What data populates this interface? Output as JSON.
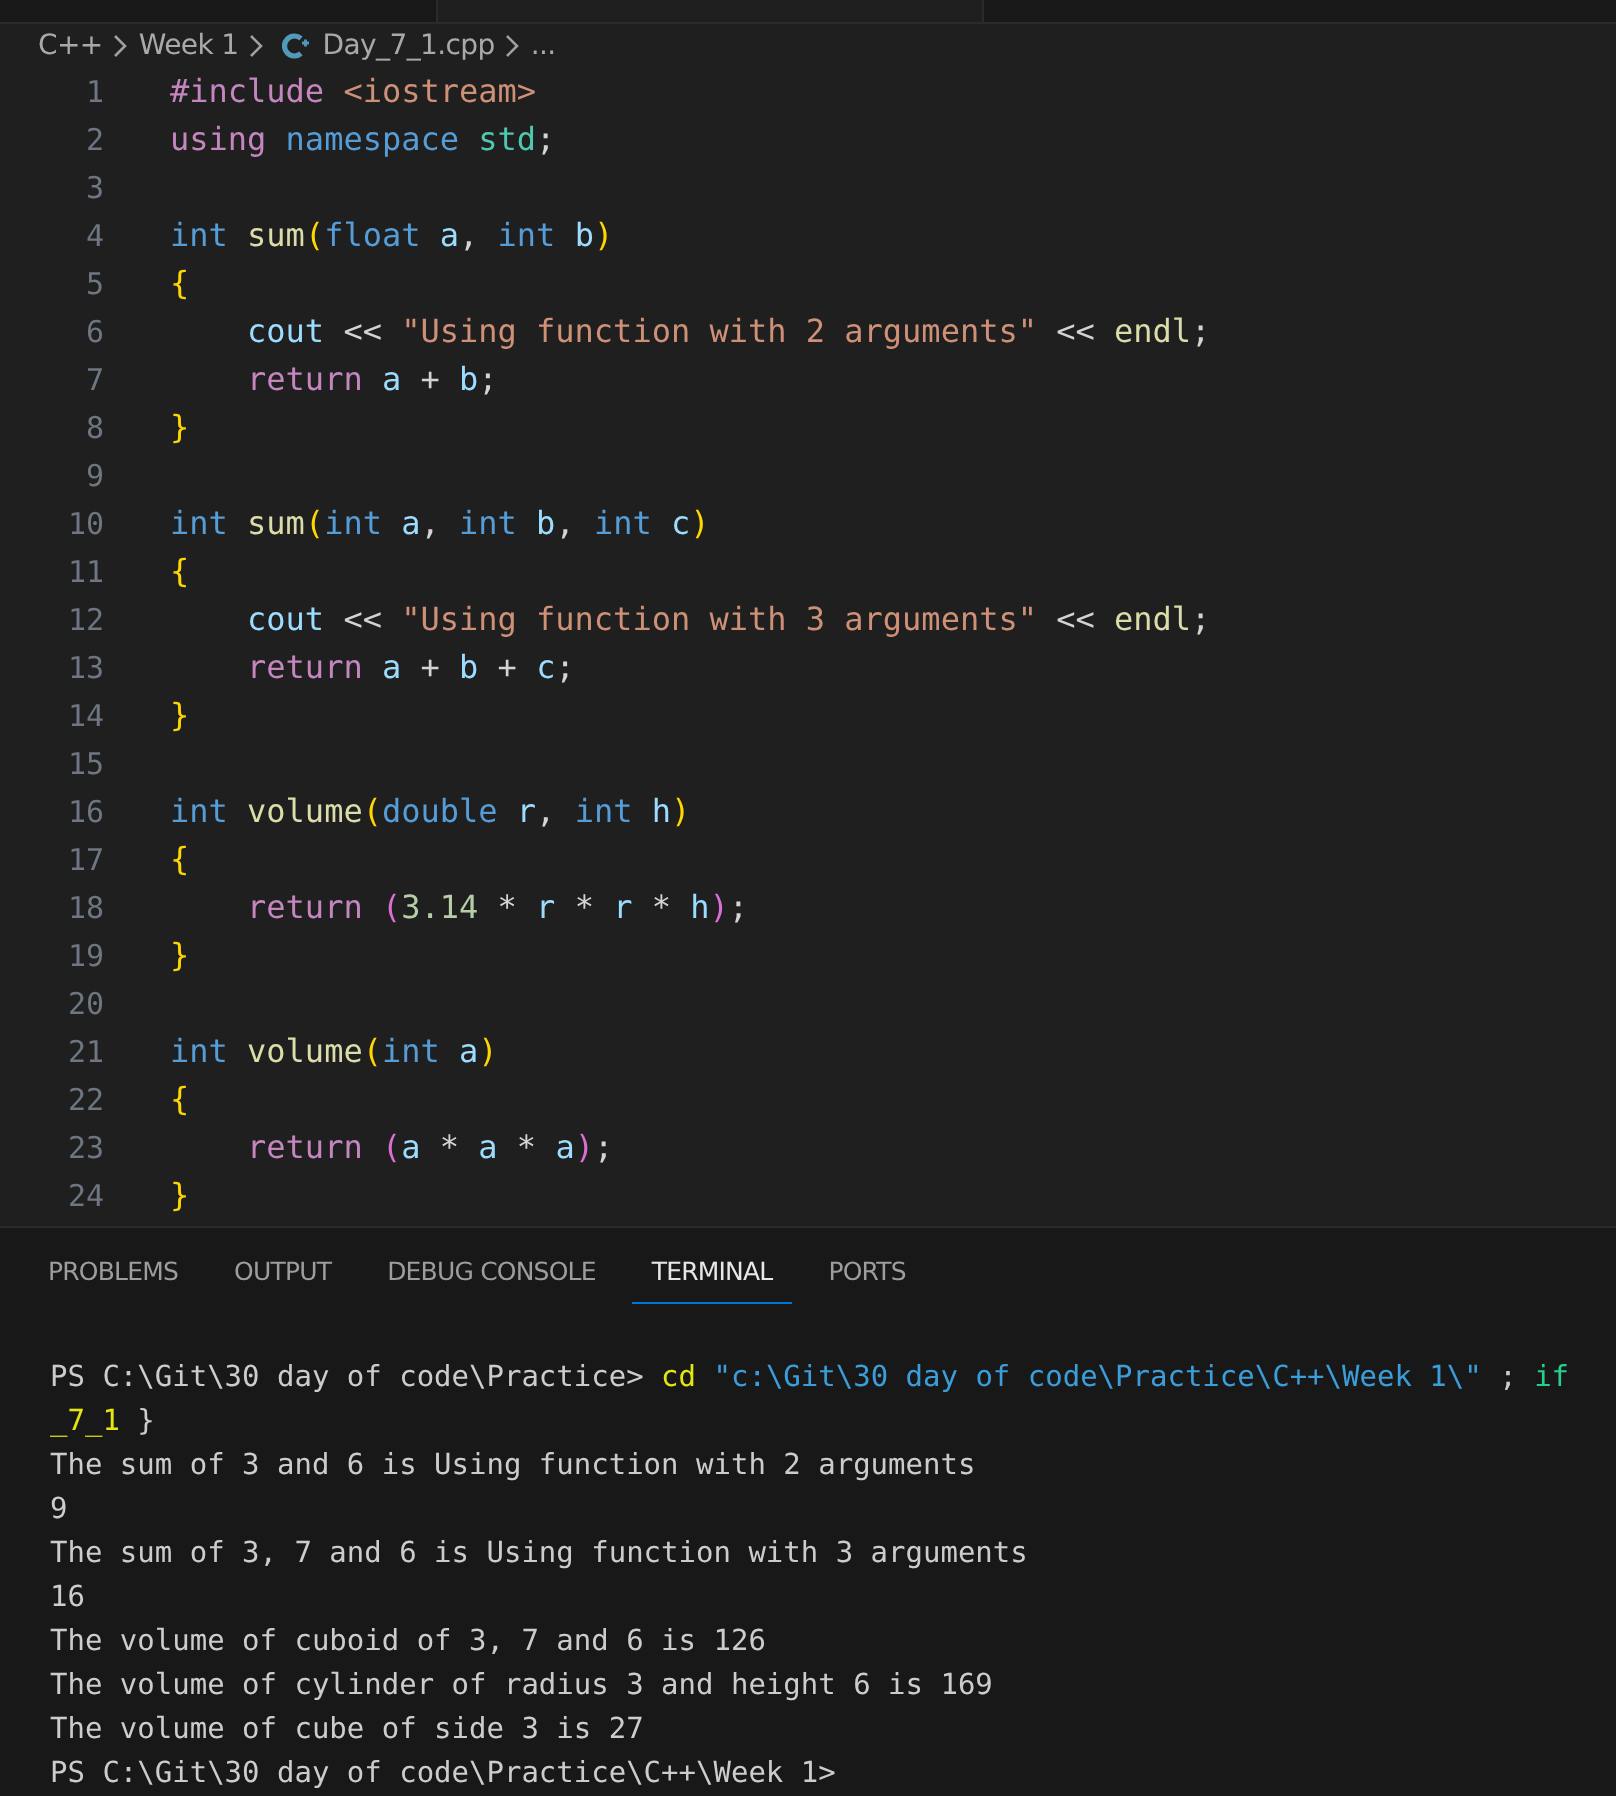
{
  "breadcrumb": {
    "items": [
      {
        "text": "C++",
        "kind": "folder"
      },
      {
        "text": "Week 1",
        "kind": "folder"
      },
      {
        "text": "Day_7_1.cpp",
        "kind": "file"
      }
    ],
    "more": "..."
  },
  "editor": {
    "lines": [
      {
        "number": "1",
        "tokens": [
          {
            "text": "#include ",
            "color": "#c586c0"
          },
          {
            "text": "<iostream>",
            "color": "#ce9178"
          }
        ]
      },
      {
        "number": "2",
        "tokens": [
          {
            "text": "using ",
            "color": "#c586c0"
          },
          {
            "text": "namespace ",
            "color": "#569cd6"
          },
          {
            "text": "std",
            "color": "#4ec9b0"
          },
          {
            "text": ";",
            "color": "#d4d4d4"
          }
        ]
      },
      {
        "number": "3"
      },
      {
        "number": "4",
        "tokens": [
          {
            "text": "int ",
            "color": "#569cd6"
          },
          {
            "text": "sum",
            "color": "#dcdcaa"
          },
          {
            "text": "(",
            "color": "#ffd700"
          },
          {
            "text": "float ",
            "color": "#569cd6"
          },
          {
            "text": "a",
            "color": "#9cdcfe"
          },
          {
            "text": ", ",
            "color": "#d4d4d4"
          },
          {
            "text": "int ",
            "color": "#569cd6"
          },
          {
            "text": "b",
            "color": "#9cdcfe"
          },
          {
            "text": ")",
            "color": "#ffd700"
          }
        ]
      },
      {
        "number": "5",
        "tokens": [
          {
            "text": "{",
            "color": "#ffd700"
          }
        ]
      },
      {
        "number": "6",
        "tokens": [
          {
            "text": "    cout",
            "color": "#9cdcfe"
          },
          {
            "text": " << ",
            "color": "#d4d4d4"
          },
          {
            "text": "\"Using function with 2 arguments\"",
            "color": "#ce9178"
          },
          {
            "text": " << ",
            "color": "#d4d4d4"
          },
          {
            "text": "endl",
            "color": "#dcdcaa"
          },
          {
            "text": ";",
            "color": "#d4d4d4"
          }
        ]
      },
      {
        "number": "7",
        "tokens": [
          {
            "text": "    return ",
            "color": "#c586c0"
          },
          {
            "text": "a",
            "color": "#9cdcfe"
          },
          {
            "text": " + ",
            "color": "#d4d4d4"
          },
          {
            "text": "b",
            "color": "#9cdcfe"
          },
          {
            "text": ";",
            "color": "#d4d4d4"
          }
        ]
      },
      {
        "number": "8",
        "tokens": [
          {
            "text": "}",
            "color": "#ffd700"
          }
        ]
      },
      {
        "number": "9"
      },
      {
        "number": "10",
        "tokens": [
          {
            "text": "int ",
            "color": "#569cd6"
          },
          {
            "text": "sum",
            "color": "#dcdcaa"
          },
          {
            "text": "(",
            "color": "#ffd700"
          },
          {
            "text": "int ",
            "color": "#569cd6"
          },
          {
            "text": "a",
            "color": "#9cdcfe"
          },
          {
            "text": ", ",
            "color": "#d4d4d4"
          },
          {
            "text": "int ",
            "color": "#569cd6"
          },
          {
            "text": "b",
            "color": "#9cdcfe"
          },
          {
            "text": ", ",
            "color": "#d4d4d4"
          },
          {
            "text": "int ",
            "color": "#569cd6"
          },
          {
            "text": "c",
            "color": "#9cdcfe"
          },
          {
            "text": ")",
            "color": "#ffd700"
          }
        ]
      },
      {
        "number": "11",
        "tokens": [
          {
            "text": "{",
            "color": "#ffd700"
          }
        ]
      },
      {
        "number": "12",
        "tokens": [
          {
            "text": "    cout",
            "color": "#9cdcfe"
          },
          {
            "text": " << ",
            "color": "#d4d4d4"
          },
          {
            "text": "\"Using function with 3 arguments\"",
            "color": "#ce9178"
          },
          {
            "text": " << ",
            "color": "#d4d4d4"
          },
          {
            "text": "endl",
            "color": "#dcdcaa"
          },
          {
            "text": ";",
            "color": "#d4d4d4"
          }
        ]
      },
      {
        "number": "13",
        "tokens": [
          {
            "text": "    return ",
            "color": "#c586c0"
          },
          {
            "text": "a",
            "color": "#9cdcfe"
          },
          {
            "text": " + ",
            "color": "#d4d4d4"
          },
          {
            "text": "b",
            "color": "#9cdcfe"
          },
          {
            "text": " + ",
            "color": "#d4d4d4"
          },
          {
            "text": "c",
            "color": "#9cdcfe"
          },
          {
            "text": ";",
            "color": "#d4d4d4"
          }
        ]
      },
      {
        "number": "14",
        "tokens": [
          {
            "text": "}",
            "color": "#ffd700"
          }
        ]
      },
      {
        "number": "15"
      },
      {
        "number": "16",
        "tokens": [
          {
            "text": "int ",
            "color": "#569cd6"
          },
          {
            "text": "volume",
            "color": "#dcdcaa"
          },
          {
            "text": "(",
            "color": "#ffd700"
          },
          {
            "text": "double ",
            "color": "#569cd6"
          },
          {
            "text": "r",
            "color": "#9cdcfe"
          },
          {
            "text": ", ",
            "color": "#d4d4d4"
          },
          {
            "text": "int ",
            "color": "#569cd6"
          },
          {
            "text": "h",
            "color": "#9cdcfe"
          },
          {
            "text": ")",
            "color": "#ffd700"
          }
        ]
      },
      {
        "number": "17",
        "tokens": [
          {
            "text": "{",
            "color": "#ffd700"
          }
        ]
      },
      {
        "number": "18",
        "tokens": [
          {
            "text": "    return ",
            "color": "#c586c0"
          },
          {
            "text": "(",
            "color": "#da70d6"
          },
          {
            "text": "3.14",
            "color": "#b5cea8"
          },
          {
            "text": " * ",
            "color": "#d4d4d4"
          },
          {
            "text": "r",
            "color": "#9cdcfe"
          },
          {
            "text": " * ",
            "color": "#d4d4d4"
          },
          {
            "text": "r",
            "color": "#9cdcfe"
          },
          {
            "text": " * ",
            "color": "#d4d4d4"
          },
          {
            "text": "h",
            "color": "#9cdcfe"
          },
          {
            "text": ")",
            "color": "#da70d6"
          },
          {
            "text": ";",
            "color": "#d4d4d4"
          }
        ]
      },
      {
        "number": "19",
        "tokens": [
          {
            "text": "}",
            "color": "#ffd700"
          }
        ]
      },
      {
        "number": "20"
      },
      {
        "number": "21",
        "tokens": [
          {
            "text": "int ",
            "color": "#569cd6"
          },
          {
            "text": "volume",
            "color": "#dcdcaa"
          },
          {
            "text": "(",
            "color": "#ffd700"
          },
          {
            "text": "int ",
            "color": "#569cd6"
          },
          {
            "text": "a",
            "color": "#9cdcfe"
          },
          {
            "text": ")",
            "color": "#ffd700"
          }
        ]
      },
      {
        "number": "22",
        "tokens": [
          {
            "text": "{",
            "color": "#ffd700"
          }
        ]
      },
      {
        "number": "23",
        "tokens": [
          {
            "text": "    return ",
            "color": "#c586c0"
          },
          {
            "text": "(",
            "color": "#da70d6"
          },
          {
            "text": "a",
            "color": "#9cdcfe"
          },
          {
            "text": " * ",
            "color": "#d4d4d4"
          },
          {
            "text": "a",
            "color": "#9cdcfe"
          },
          {
            "text": " * ",
            "color": "#d4d4d4"
          },
          {
            "text": "a",
            "color": "#9cdcfe"
          },
          {
            "text": ")",
            "color": "#da70d6"
          },
          {
            "text": ";",
            "color": "#d4d4d4"
          }
        ]
      },
      {
        "number": "24",
        "tokens": [
          {
            "text": "}",
            "color": "#ffd700"
          }
        ]
      }
    ]
  },
  "panel": {
    "tabs": [
      {
        "label": "PROBLEMS",
        "selected": false
      },
      {
        "label": "OUTPUT",
        "selected": false
      },
      {
        "label": "DEBUG CONSOLE",
        "selected": false
      },
      {
        "label": "TERMINAL",
        "selected": true
      },
      {
        "label": "PORTS",
        "selected": false
      }
    ],
    "terminal": {
      "lines": [
        {
          "tokens": [
            {
              "text": "PS C:\\Git\\30 day of code\\Practice> ",
              "color": "#cccccc"
            },
            {
              "text": "cd ",
              "color": "#e5e510"
            },
            {
              "text": "\"c:\\Git\\30 day of code\\Practice\\C++\\Week 1\\\"",
              "color": "#3b9edb"
            },
            {
              "text": " ; ",
              "color": "#cccccc"
            },
            {
              "text": "if",
              "color": "#23d18b"
            }
          ]
        },
        {
          "tokens": [
            {
              "text": "_7_1",
              "color": "#e5e510"
            },
            {
              "text": " }",
              "color": "#cccccc"
            }
          ]
        },
        {
          "tokens": [
            {
              "text": "The sum of 3 and 6 is Using function with 2 arguments",
              "color": "#cccccc"
            }
          ]
        },
        {
          "tokens": [
            {
              "text": "9",
              "color": "#cccccc"
            }
          ]
        },
        {
          "tokens": [
            {
              "text": "The sum of 3, 7 and 6 is Using function with 3 arguments",
              "color": "#cccccc"
            }
          ]
        },
        {
          "tokens": [
            {
              "text": "16",
              "color": "#cccccc"
            }
          ]
        },
        {
          "tokens": [
            {
              "text": "The volume of cuboid of 3, 7 and 6 is 126",
              "color": "#cccccc"
            }
          ]
        },
        {
          "tokens": [
            {
              "text": "The volume of cylinder of radius 3 and height 6 is 169",
              "color": "#cccccc"
            }
          ]
        },
        {
          "tokens": [
            {
              "text": "The volume of cube of side 3 is 27",
              "color": "#cccccc"
            }
          ]
        },
        {
          "tokens": [
            {
              "text": "PS C:\\Git\\30 day of code\\Practice\\C++\\Week 1>",
              "color": "#cccccc"
            }
          ]
        }
      ]
    }
  }
}
